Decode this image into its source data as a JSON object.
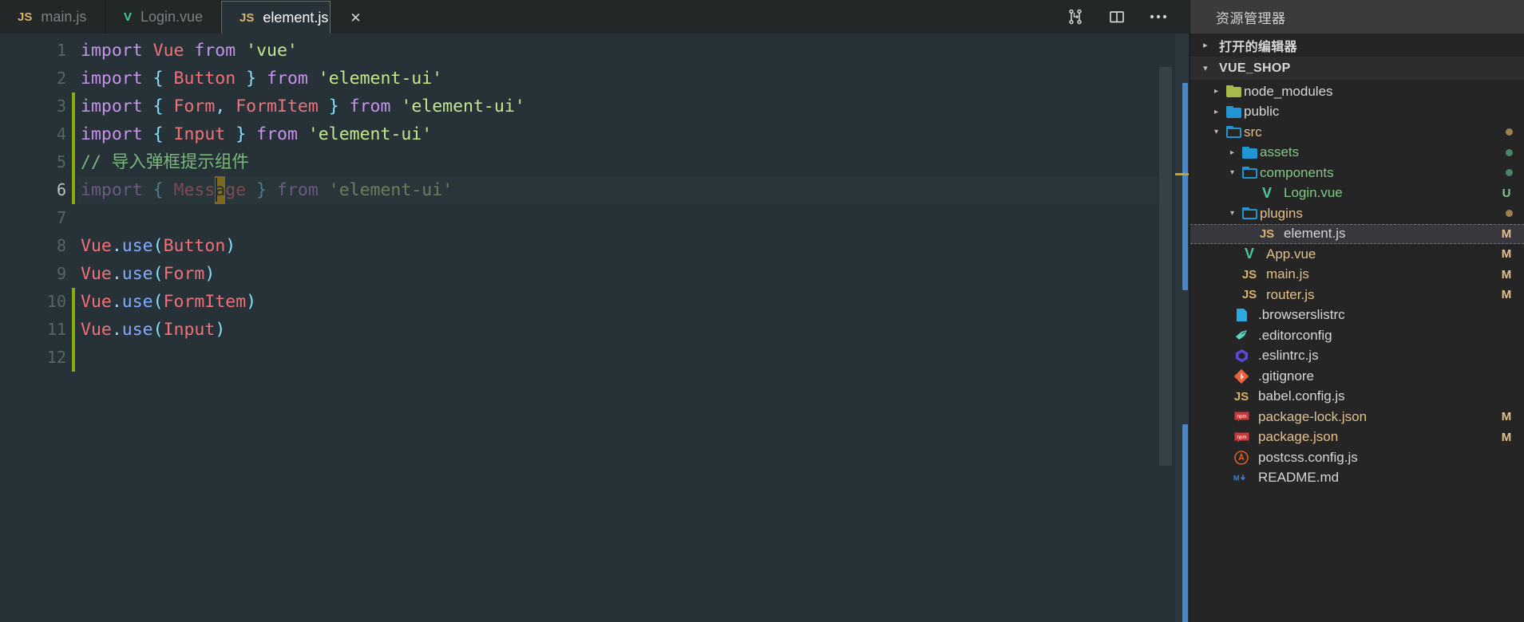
{
  "tabs": [
    {
      "label": "main.js",
      "icon": "js-icon",
      "active": false,
      "closable": false
    },
    {
      "label": "Login.vue",
      "icon": "vue-icon",
      "active": false,
      "closable": false
    },
    {
      "label": "element.js",
      "icon": "js-icon",
      "active": true,
      "closable": true,
      "close_glyph": "✕"
    }
  ],
  "toolbar": {
    "compare_changes": "compare-changes-icon",
    "split_editor": "split-editor-icon",
    "more_actions": "more-actions-icon",
    "more_glyph": "•••"
  },
  "editor": {
    "filename": "element.js",
    "language": "javascript",
    "cursor_line": 6,
    "total_lines": 12,
    "line_numbers": [
      "1",
      "2",
      "3",
      "4",
      "5",
      "6",
      "7",
      "8",
      "9",
      "10",
      "11",
      "12"
    ],
    "lines": [
      "import Vue from 'vue'",
      "import { Button } from 'element-ui'",
      "import { Form, FormItem } from 'element-ui'",
      "import { Input } from 'element-ui'",
      "// 导入弹框提示组件",
      "import { Message } from 'element-ui'",
      "",
      "Vue.use(Button)",
      "Vue.use(Form)",
      "Vue.use(FormItem)",
      "Vue.use(Input)",
      ""
    ],
    "comment_text": "导入弹框提示组件",
    "highlighted_char": "a",
    "colors": {
      "background": "#263238",
      "keyword": "#c792ea",
      "class": "#f07178",
      "string": "#c3e88d",
      "punctuation": "#89ddff",
      "comment": "#79b87a",
      "function": "#82aaff",
      "caret_highlight": "#f5b700",
      "git_modified": "#8bac0f",
      "tab_active_border": "#e03a34"
    }
  },
  "sidebar": {
    "title": "资源管理器",
    "sections": [
      {
        "label": "打开的编辑器",
        "expanded": false,
        "twisty": "▸"
      },
      {
        "label": "VUE_SHOP",
        "expanded": true,
        "twisty": "▾"
      }
    ],
    "tree": [
      {
        "label": "node_modules",
        "type": "folder",
        "icon": "folder-node-modules-icon",
        "indent": 1,
        "twisty": "▸",
        "badge": "",
        "badge_color": "",
        "text_color": "white",
        "dot": ""
      },
      {
        "label": "public",
        "type": "folder",
        "icon": "folder-filled-icon",
        "indent": 1,
        "twisty": "▸",
        "badge": "",
        "badge_color": "",
        "text_color": "white",
        "dot": ""
      },
      {
        "label": "src",
        "type": "folder",
        "icon": "folder-open-icon",
        "indent": 1,
        "twisty": "▾",
        "badge": "",
        "badge_color": "",
        "text_color": "orange",
        "dot": "#9c8052"
      },
      {
        "label": "assets",
        "type": "folder",
        "icon": "folder-filled-icon",
        "indent": 2,
        "twisty": "▸",
        "badge": "",
        "badge_color": "",
        "text_color": "green",
        "dot": "#4c8468"
      },
      {
        "label": "components",
        "type": "folder",
        "icon": "folder-open-icon",
        "indent": 2,
        "twisty": "▾",
        "badge": "",
        "badge_color": "",
        "text_color": "green",
        "dot": "#4c8468"
      },
      {
        "label": "Login.vue",
        "type": "file",
        "icon": "vue-icon",
        "indent": 3,
        "twisty": "",
        "badge": "U",
        "badge_color": "#81c784",
        "text_color": "green",
        "dot": ""
      },
      {
        "label": "plugins",
        "type": "folder",
        "icon": "folder-open-icon",
        "indent": 2,
        "twisty": "▾",
        "badge": "",
        "badge_color": "",
        "text_color": "orange",
        "dot": "#9c8052"
      },
      {
        "label": "element.js",
        "type": "file",
        "icon": "js-icon",
        "indent": 3,
        "twisty": "",
        "badge": "M",
        "badge_color": "#e2c08d",
        "text_color": "white",
        "dot": "",
        "selected": true
      },
      {
        "label": "App.vue",
        "type": "file",
        "icon": "vue-icon",
        "indent": 2,
        "twisty": "",
        "badge": "M",
        "badge_color": "#e2c08d",
        "text_color": "orange",
        "dot": ""
      },
      {
        "label": "main.js",
        "type": "file",
        "icon": "js-icon",
        "indent": 2,
        "twisty": "",
        "badge": "M",
        "badge_color": "#e2c08d",
        "text_color": "orange",
        "dot": ""
      },
      {
        "label": "router.js",
        "type": "file",
        "icon": "js-icon",
        "indent": 2,
        "twisty": "",
        "badge": "M",
        "badge_color": "#e2c08d",
        "text_color": "orange",
        "dot": ""
      },
      {
        "label": ".browserslistrc",
        "type": "file",
        "icon": "browserslist-icon",
        "indent": 1,
        "twisty": "",
        "badge": "",
        "badge_color": "",
        "text_color": "white",
        "dot": ""
      },
      {
        "label": ".editorconfig",
        "type": "file",
        "icon": "editorconfig-icon",
        "indent": 1,
        "twisty": "",
        "badge": "",
        "badge_color": "",
        "text_color": "white",
        "dot": ""
      },
      {
        "label": ".eslintrc.js",
        "type": "file",
        "icon": "eslint-icon",
        "indent": 1,
        "twisty": "",
        "badge": "",
        "badge_color": "",
        "text_color": "white",
        "dot": ""
      },
      {
        "label": ".gitignore",
        "type": "file",
        "icon": "git-icon",
        "indent": 1,
        "twisty": "",
        "badge": "",
        "badge_color": "",
        "text_color": "white",
        "dot": ""
      },
      {
        "label": "babel.config.js",
        "type": "file",
        "icon": "js-icon",
        "indent": 1,
        "twisty": "",
        "badge": "",
        "badge_color": "",
        "text_color": "white",
        "dot": ""
      },
      {
        "label": "package-lock.json",
        "type": "file",
        "icon": "npm-icon",
        "indent": 1,
        "twisty": "",
        "badge": "M",
        "badge_color": "#e2c08d",
        "text_color": "orange",
        "dot": ""
      },
      {
        "label": "package.json",
        "type": "file",
        "icon": "npm-icon",
        "indent": 1,
        "twisty": "",
        "badge": "M",
        "badge_color": "#e2c08d",
        "text_color": "orange",
        "dot": ""
      },
      {
        "label": "postcss.config.js",
        "type": "file",
        "icon": "postcss-icon",
        "indent": 1,
        "twisty": "",
        "badge": "",
        "badge_color": "",
        "text_color": "white",
        "dot": ""
      },
      {
        "label": "README.md",
        "type": "file",
        "icon": "markdown-icon",
        "indent": 1,
        "twisty": "",
        "badge": "",
        "badge_color": "",
        "text_color": "white",
        "dot": ""
      }
    ]
  }
}
